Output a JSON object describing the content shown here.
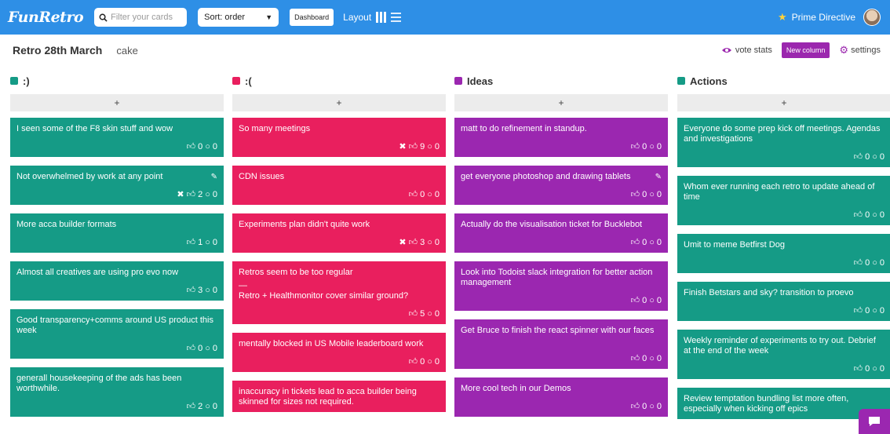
{
  "app": {
    "logo": "FunRetro"
  },
  "toolbar": {
    "search_placeholder": "Filter your cards",
    "sort_value": "Sort: order",
    "dashboard_label": "Dashboard",
    "layout_label": "Layout",
    "prime_directive_label": "Prime Directive"
  },
  "board": {
    "title": "Retro 28th March",
    "subtitle": "cake"
  },
  "actions": {
    "vote_stats": "vote stats",
    "new_column": "New column",
    "settings": "settings"
  },
  "colors": {
    "green": "#159b86",
    "red": "#e91f5e",
    "purple": "#9b27b0",
    "topbar": "#2e8fe6"
  },
  "columns": [
    {
      "title": ":)",
      "color": "#159b86",
      "add_label": "+",
      "cards": [
        {
          "text": "I seen some of the F8 skin stuff and wow",
          "votes": "0",
          "comments": "0",
          "x": ""
        },
        {
          "text": "Not overwhelmed by work at any point",
          "votes": "2",
          "comments": "0",
          "x": "✖"
        },
        {
          "text": "More acca builder formats",
          "votes": "1",
          "comments": "0",
          "x": ""
        },
        {
          "text": "Almost all creatives are using pro evo now",
          "votes": "3",
          "comments": "0",
          "x": ""
        },
        {
          "text": "Good transparency+comms around US product this week",
          "votes": "0",
          "comments": "0",
          "x": ""
        },
        {
          "text": "generall housekeeping of the ads has been worthwhile.",
          "votes": "2",
          "comments": "0",
          "x": ""
        }
      ]
    },
    {
      "title": ":(",
      "color": "#e91f5e",
      "add_label": "+",
      "cards": [
        {
          "text": "So many meetings",
          "votes": "9",
          "comments": "0",
          "x": "✖"
        },
        {
          "text": "CDN issues",
          "votes": "0",
          "comments": "0",
          "x": ""
        },
        {
          "text": "Experiments plan didn't quite work",
          "votes": "3",
          "comments": "0",
          "x": "✖"
        },
        {
          "text": "Retros seem to be too regular",
          "text2": "Retro + Healthmonitor cover similar ground?",
          "votes": "5",
          "comments": "0",
          "x": ""
        },
        {
          "text": "mentally blocked in US Mobile leaderboard work",
          "votes": "0",
          "comments": "0",
          "x": ""
        },
        {
          "text": "inaccuracy in tickets lead to acca builder being skinned for sizes not required.",
          "votes": "",
          "comments": "",
          "x": ""
        }
      ]
    },
    {
      "title": "Ideas",
      "color": "#9b27b0",
      "add_label": "+",
      "cards": [
        {
          "text": "matt to do refinement in standup.",
          "votes": "0",
          "comments": "0",
          "x": ""
        },
        {
          "text": "get everyone photoshop and drawing tablets",
          "votes": "0",
          "comments": "0",
          "x": ""
        },
        {
          "text": "Actually do the visualisation ticket for Bucklebot",
          "votes": "0",
          "comments": "0",
          "x": ""
        },
        {
          "text": "Look into Todoist slack integration for better action management",
          "votes": "0",
          "comments": "0",
          "x": ""
        },
        {
          "text": "Get Bruce to finish the react spinner with our faces",
          "votes": "0",
          "comments": "0",
          "x": ""
        },
        {
          "text": "More cool tech in our Demos",
          "votes": "0",
          "comments": "0",
          "x": ""
        }
      ]
    },
    {
      "title": "Actions",
      "color": "#159b86",
      "add_label": "+",
      "cards": [
        {
          "text": "Everyone do some prep kick off meetings. Agendas and investigations",
          "votes": "0",
          "comments": "0",
          "x": ""
        },
        {
          "text": "Whom ever running each retro to update ahead of time",
          "votes": "0",
          "comments": "0",
          "x": ""
        },
        {
          "text": "Umit to meme Betfirst Dog",
          "votes": "0",
          "comments": "0",
          "x": ""
        },
        {
          "text": "Finish Betstars and sky? transition to proevo",
          "votes": "0",
          "comments": "0",
          "x": ""
        },
        {
          "text": "Weekly reminder of experiments to try out. Debrief at the end of the week",
          "votes": "0",
          "comments": "0",
          "x": ""
        },
        {
          "text": "Review temptation bundling list more often, especially when kicking off epics",
          "votes": "",
          "comments": "",
          "x": ""
        }
      ]
    }
  ]
}
